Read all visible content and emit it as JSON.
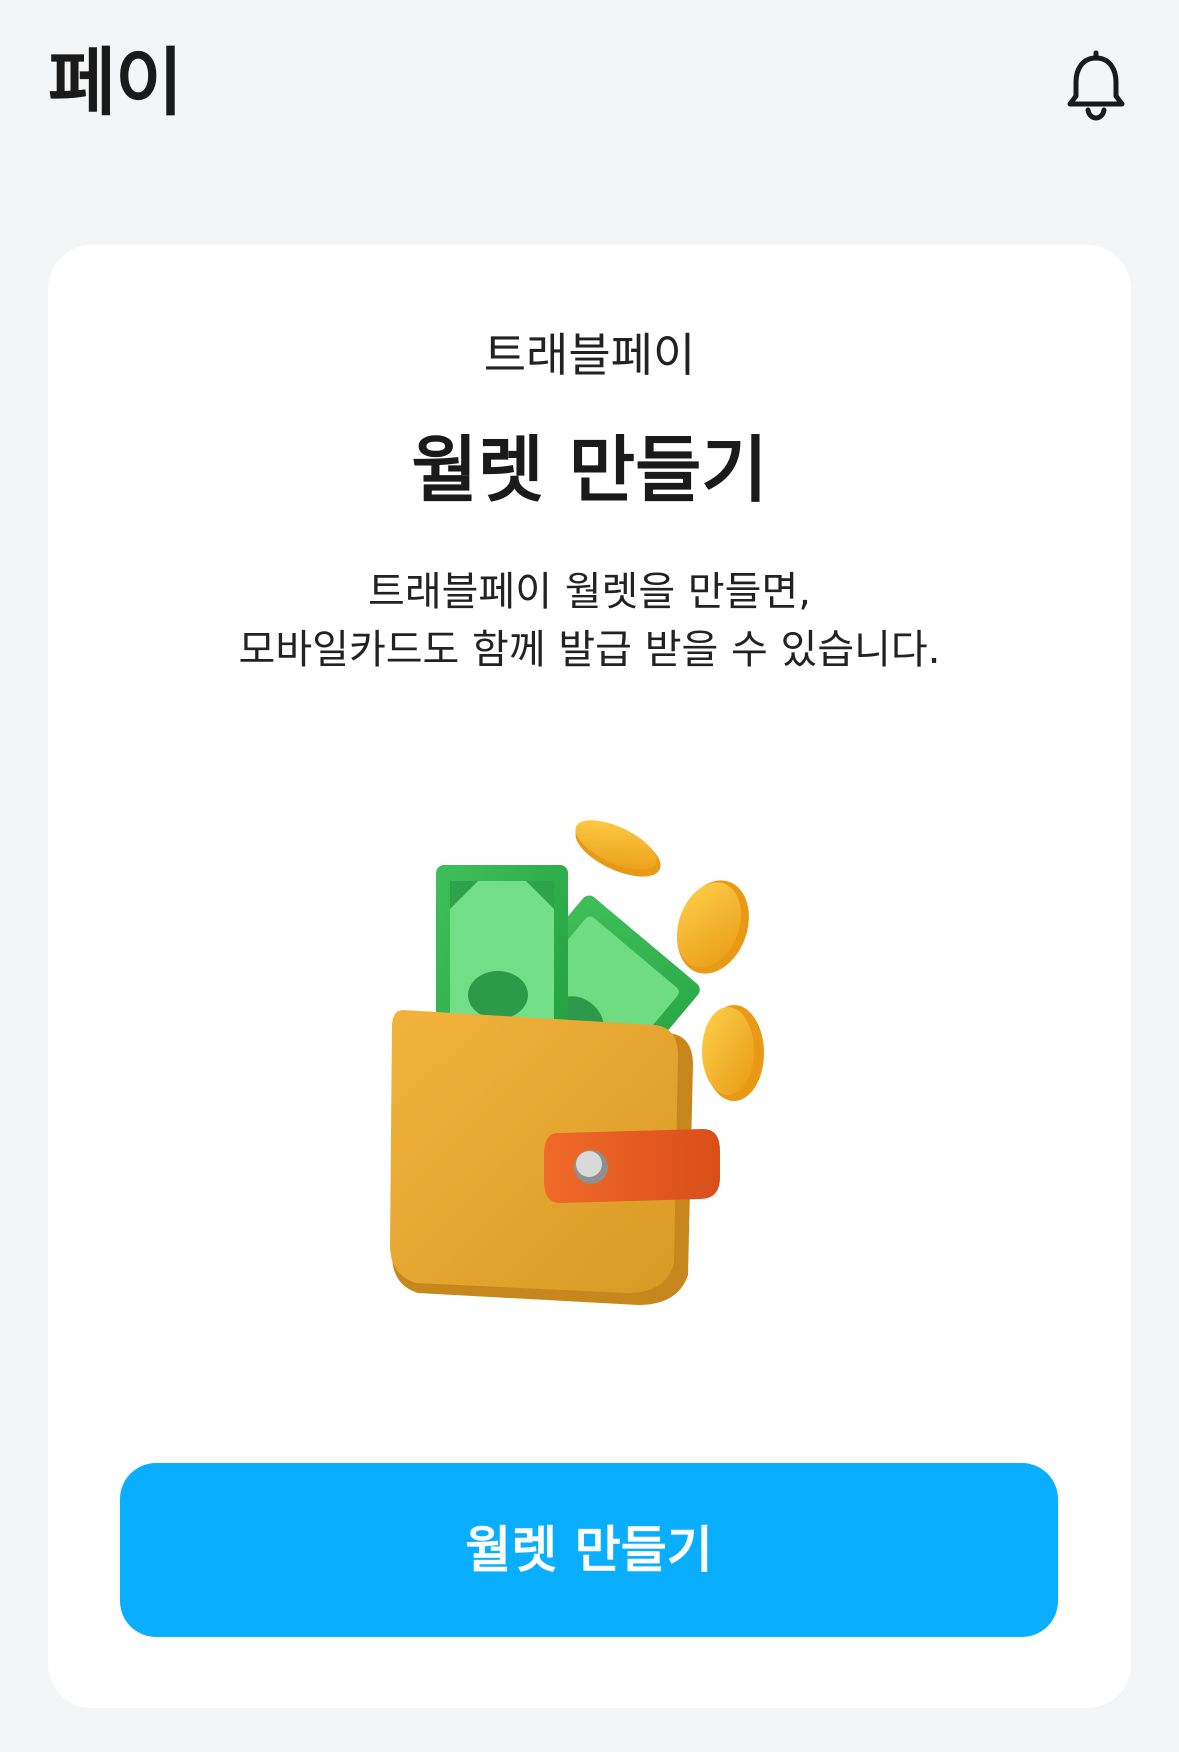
{
  "header": {
    "title": "페이",
    "notification_icon": "bell-icon"
  },
  "card": {
    "eyebrow": "트래블페이",
    "headline": "월렛 만들기",
    "description_line1": "트래블페이 월렛을 만들면,",
    "description_line2": "모바일카드도 함께 발급 받을 수 있습니다.",
    "illustration": "wallet-with-cash-and-coins",
    "cta_label": "월렛 만들기"
  },
  "colors": {
    "background": "#f4f5f7",
    "card": "#ffffff",
    "accent": "#0aaeff",
    "text": "#1a1a1a"
  }
}
